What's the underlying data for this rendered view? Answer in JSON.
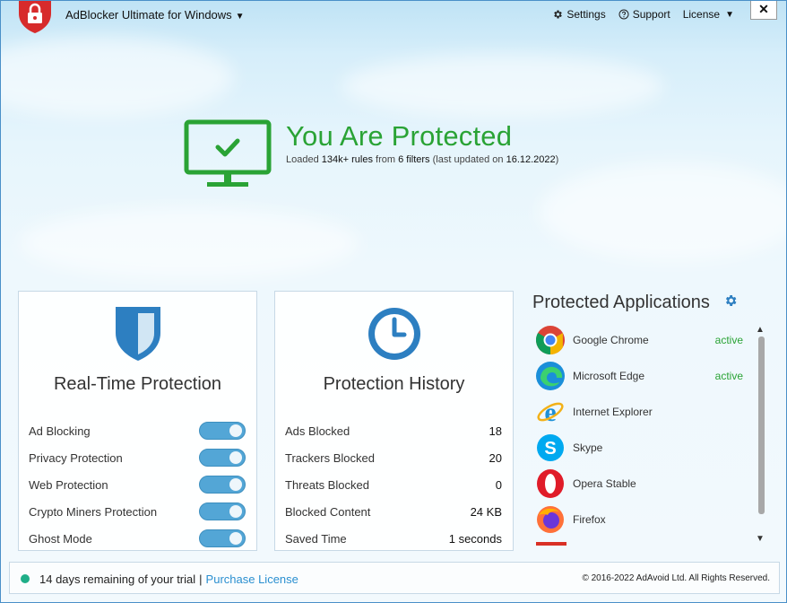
{
  "titlebar": {
    "app_title": "AdBlocker Ultimate for Windows",
    "settings_label": "Settings",
    "support_label": "Support",
    "license_label": "License",
    "close_label": "✕"
  },
  "hero": {
    "title": "You Are Protected",
    "sub_loaded": "Loaded",
    "sub_rules": "134k+ rules",
    "sub_from": "from",
    "sub_filters": "6 filters",
    "sub_last_updated": "(last updated on",
    "sub_date": "16.12.2022",
    "sub_close": ")"
  },
  "realtime": {
    "title": "Real-Time Protection",
    "items": [
      {
        "label": "Ad Blocking",
        "enabled": true
      },
      {
        "label": "Privacy Protection",
        "enabled": true
      },
      {
        "label": "Web Protection",
        "enabled": true
      },
      {
        "label": "Crypto Miners Protection",
        "enabled": true
      },
      {
        "label": "Ghost Mode",
        "enabled": true
      }
    ]
  },
  "history": {
    "title": "Protection History",
    "items": [
      {
        "label": "Ads Blocked",
        "value": "18"
      },
      {
        "label": "Trackers Blocked",
        "value": "20"
      },
      {
        "label": "Threats Blocked",
        "value": "0"
      },
      {
        "label": "Blocked Content",
        "value": "24 KB"
      },
      {
        "label": "Saved Time",
        "value": "1 seconds"
      }
    ]
  },
  "apps": {
    "title": "Protected Applications",
    "items": [
      {
        "name": "Google Chrome",
        "status": "active",
        "icon": "chrome-icon"
      },
      {
        "name": "Microsoft Edge",
        "status": "active",
        "icon": "edge-icon"
      },
      {
        "name": "Internet Explorer",
        "status": "",
        "icon": "internet-explorer-icon"
      },
      {
        "name": "Skype",
        "status": "",
        "icon": "skype-icon"
      },
      {
        "name": "Opera Stable",
        "status": "",
        "icon": "opera-icon"
      },
      {
        "name": "Firefox",
        "status": "",
        "icon": "firefox-icon"
      }
    ]
  },
  "footer": {
    "trial_text": "14 days remaining of your trial",
    "separator": "|",
    "purchase_link": "Purchase License",
    "copyright": "© 2016-2022 AdAvoid Ltd. All Rights Reserved."
  },
  "colors": {
    "accent_green": "#2aa335",
    "accent_blue": "#2a8fd0",
    "toggle_blue": "#53a6d6",
    "shield_red": "#d72b2b"
  }
}
